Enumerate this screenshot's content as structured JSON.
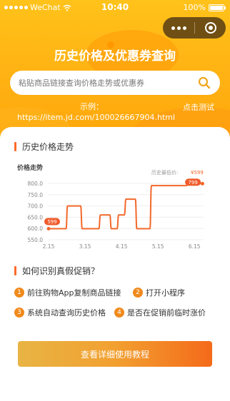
{
  "status_bar": {
    "carrier": "WeChat",
    "time": "10:40",
    "battery": "100%"
  },
  "header": {
    "title": "历史价格及优惠券查询"
  },
  "search": {
    "placeholder": "粘贴商品链接查询价格走势或优惠券"
  },
  "example": {
    "label": "示例：",
    "url": "https://item.jd.com/100026667904.html",
    "test_label": "点击测试"
  },
  "trend_section": {
    "title": "历史价格走势"
  },
  "chart_data": {
    "type": "line",
    "title": "价格走势",
    "legend": "历史最低价:",
    "legend_value": "¥599",
    "x_ticks": [
      "2.15",
      "3.15",
      "4.15",
      "5.15",
      "6.15"
    ],
    "y_ticks": [
      "800.0",
      "750.0",
      "700.0",
      "650.0",
      "600.0",
      "550.0"
    ],
    "ylim": [
      550,
      800
    ],
    "xlim": [
      0,
      4.25
    ],
    "series": [
      {
        "x": [
          0,
          0.48,
          0.52,
          0.88,
          0.92,
          1.38,
          1.42,
          1.68,
          1.72,
          1.88,
          1.92,
          2.08,
          2.12,
          2.38,
          2.42,
          2.78,
          2.82,
          3.78,
          3.82,
          4.22
        ],
        "y": [
          599,
          599,
          700,
          700,
          599,
          599,
          660,
          660,
          599,
          599,
          660,
          660,
          730,
          730,
          599,
          599,
          790,
          790,
          799,
          799
        ]
      }
    ],
    "annotations": [
      {
        "x": 0,
        "y": 599,
        "text": "599"
      },
      {
        "x": 3.9,
        "y": 799,
        "text": "799"
      }
    ],
    "accent": "#f2682a"
  },
  "promo_section": {
    "title": "如何识别真假促销？"
  },
  "steps": [
    {
      "num": "1",
      "text": "前往购物App复制商品链接"
    },
    {
      "num": "2",
      "text": "打开小程序"
    },
    {
      "num": "3",
      "text": "系统自动查询历史价格"
    },
    {
      "num": "4",
      "text": "是否在促销前临时涨价"
    }
  ],
  "cta": {
    "label": "查看详细使用教程"
  },
  "colors": {
    "brand": "#ffb012",
    "accent": "#f2682a"
  }
}
